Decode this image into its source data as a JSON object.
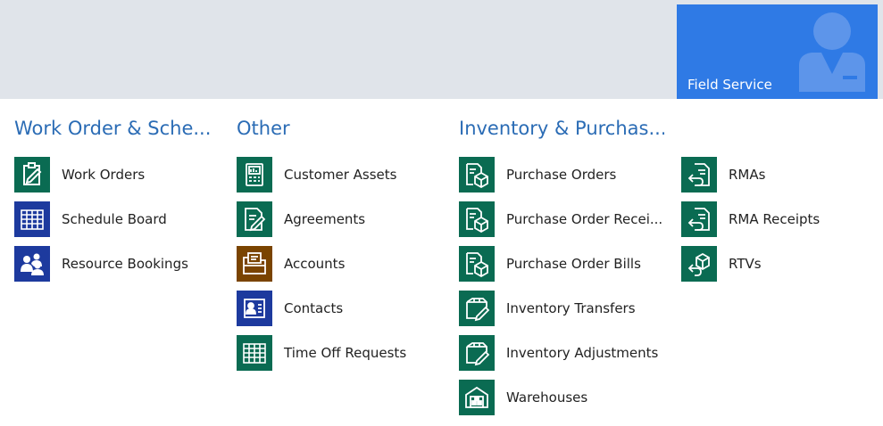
{
  "tile": {
    "label": "Field Service",
    "icon": "user-silhouette-icon",
    "color": "#2f7ae5"
  },
  "colors": {
    "accent": "#2b6cb5",
    "green": "#0a6b52",
    "blue": "#1d3a9e",
    "brown": "#7a4400",
    "header_bg": "#e0e4ea"
  },
  "columns": [
    {
      "title": "Work Order & Sche...",
      "items": [
        {
          "label": "Work Orders",
          "icon": "clipboard-edit-icon"
        },
        {
          "label": "Schedule Board",
          "icon": "calendar-grid-icon"
        },
        {
          "label": "Resource Bookings",
          "icon": "people-group-icon"
        }
      ]
    },
    {
      "title": "Other",
      "items": [
        {
          "label": "Customer Assets",
          "icon": "asset-device-icon"
        },
        {
          "label": "Agreements",
          "icon": "document-edit-icon"
        },
        {
          "label": "Accounts",
          "icon": "account-folder-icon"
        },
        {
          "label": "Contacts",
          "icon": "contact-card-icon"
        },
        {
          "label": "Time Off Requests",
          "icon": "calendar-grid-icon"
        }
      ]
    },
    {
      "title": "Inventory & Purchas...",
      "items": [
        {
          "label": "Purchase Orders",
          "icon": "order-box-icon"
        },
        {
          "label": "Purchase Order Recei...",
          "icon": "order-box-icon"
        },
        {
          "label": "Purchase Order Bills",
          "icon": "order-box-icon"
        },
        {
          "label": "Inventory Transfers",
          "icon": "box-edit-icon"
        },
        {
          "label": "Inventory Adjustments",
          "icon": "box-edit-icon"
        },
        {
          "label": "Warehouses",
          "icon": "warehouse-icon"
        }
      ]
    },
    {
      "title": "",
      "items": [
        {
          "label": "RMAs",
          "icon": "return-document-icon"
        },
        {
          "label": "RMA Receipts",
          "icon": "return-document-icon"
        },
        {
          "label": "RTVs",
          "icon": "return-box-icon"
        }
      ]
    }
  ]
}
